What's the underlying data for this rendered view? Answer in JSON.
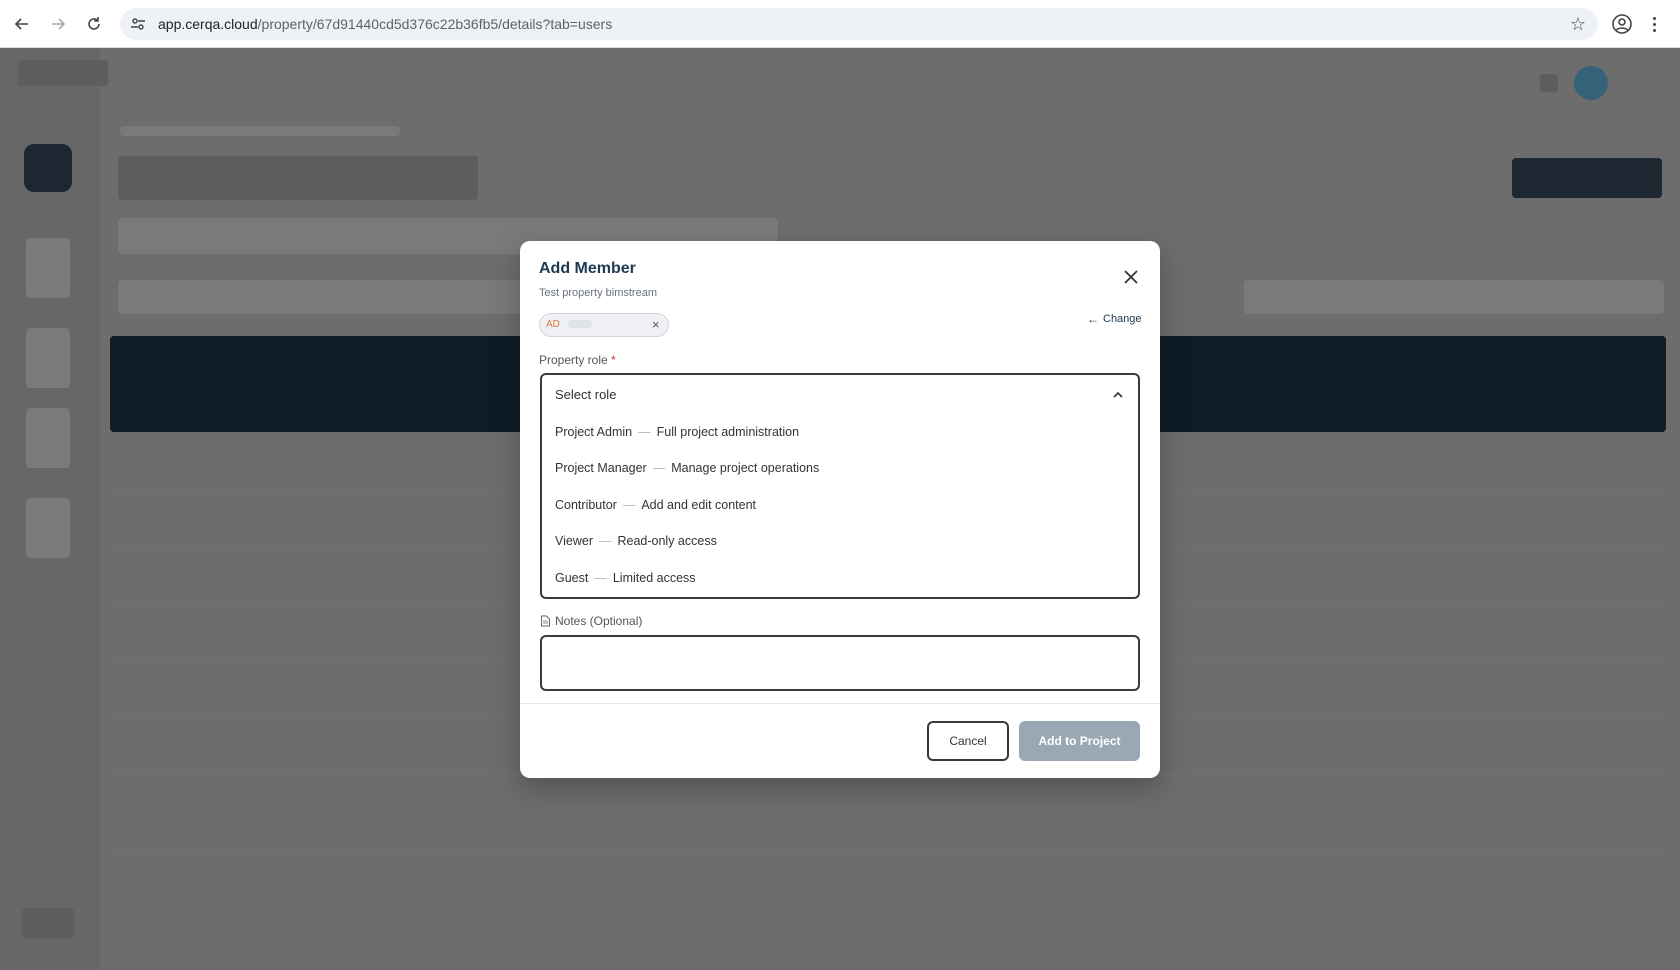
{
  "browser": {
    "url_host": "app.cerqa.cloud",
    "url_path": "/property/67d91440cd5d376c22b36fb5/details?tab=users",
    "icons": [
      "back-icon",
      "forward-icon",
      "reload-icon",
      "site-settings-icon",
      "bookmark-star-icon",
      "profile-icon",
      "more-icon"
    ]
  },
  "modal": {
    "title": "Add Member",
    "subtitle": "Test property bimstream",
    "selected_user": {
      "initials": "AD"
    },
    "change_label": "Change",
    "role_label": "Property role",
    "required_mark": "*",
    "role_select": {
      "placeholder": "Select role",
      "expanded": true,
      "options": [
        {
          "name": "Project Admin",
          "desc": "Full project administration"
        },
        {
          "name": "Project Manager",
          "desc": "Manage project operations"
        },
        {
          "name": "Contributor",
          "desc": "Add and edit content"
        },
        {
          "name": "Viewer",
          "desc": "Read-only access"
        },
        {
          "name": "Guest",
          "desc": "Limited access"
        }
      ]
    },
    "notes_label": "Notes (Optional)",
    "notes_value": "",
    "cancel_label": "Cancel",
    "submit_label": "Add to Project"
  },
  "colors": {
    "title": "#1e3a52",
    "submit_disabled": "#9aa8b6",
    "overlay": "#6b6b6b",
    "chip_initials": "#e07b39",
    "required": "#c0392b"
  }
}
